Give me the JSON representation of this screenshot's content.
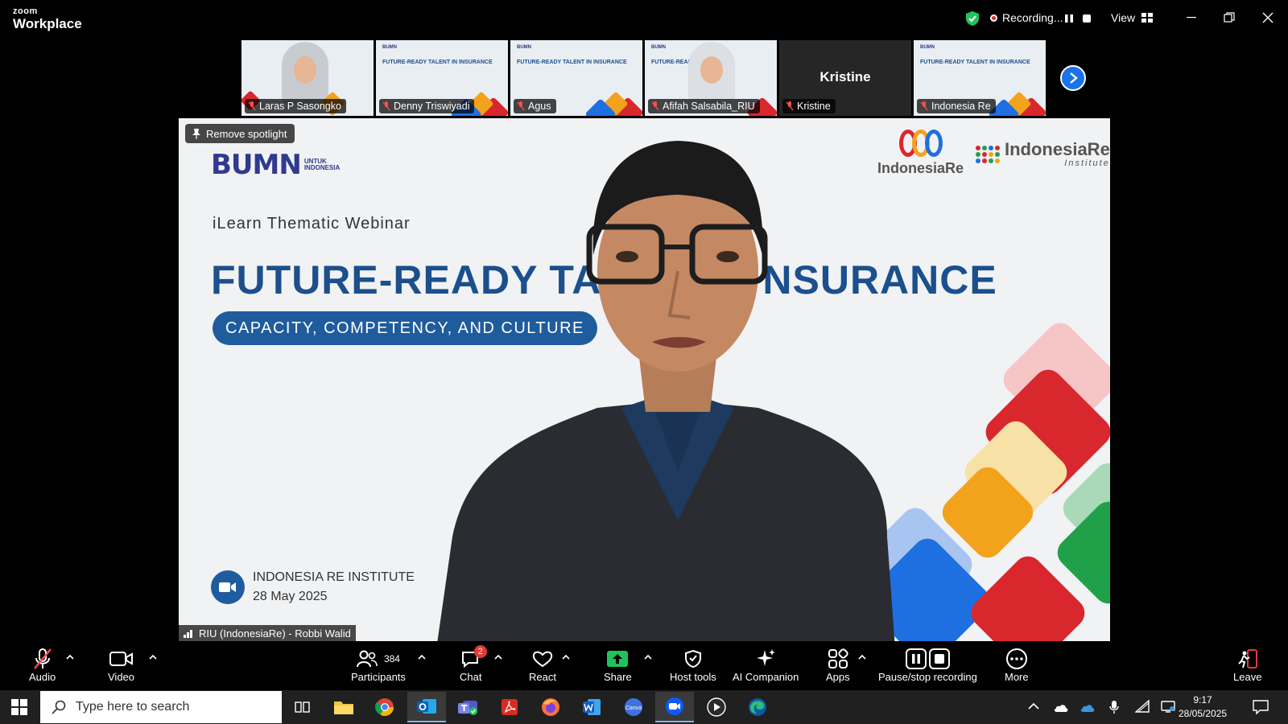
{
  "titlebar": {
    "brand_top": "zoom",
    "brand_bottom": "Workplace",
    "recording_label": "Recording...",
    "view_label": "View"
  },
  "thumbnails": [
    {
      "name": "Laras P Sasongko",
      "kind": "video"
    },
    {
      "name": "Denny Triswiyadi",
      "kind": "slide"
    },
    {
      "name": "Agus",
      "kind": "slide"
    },
    {
      "name": "Afifah Salsabila_RIU",
      "kind": "video"
    },
    {
      "name": "Kristine",
      "kind": "name",
      "display": "Kristine"
    },
    {
      "name": "Indonesia Re",
      "kind": "slide"
    }
  ],
  "stage": {
    "spotlight_label": "Remove spotlight",
    "bumn_word": "BUMN",
    "bumn_small_1": "UNTUK",
    "bumn_small_2": "INDONESIA",
    "ir_logo": "IndonesiaRe",
    "iri_logo_1": "IndonesiaRe",
    "iri_logo_2": "Institute",
    "webinar_subtitle": "iLearn Thematic Webinar",
    "headline_left": "FUTURE-READY TA",
    "headline_right": "NSURANCE",
    "pill": "CAPACITY, COMPETENCY, AND CULTURE",
    "institute": "INDONESIA RE INSTITUTE",
    "date": "28 May 2025",
    "speaker": "RIU (IndonesiaRe) - Robbi Walid"
  },
  "toolbar": {
    "audio": "Audio",
    "video": "Video",
    "participants": "Participants",
    "participants_count": "384",
    "chat": "Chat",
    "chat_badge": "2",
    "react": "React",
    "share": "Share",
    "host_tools": "Host tools",
    "ai_companion": "AI Companion",
    "apps": "Apps",
    "pause_stop": "Pause/stop recording",
    "more": "More",
    "leave": "Leave"
  },
  "taskbar": {
    "search_placeholder": "Type here to search",
    "time": "9:17",
    "date": "28/05/2025"
  },
  "colors": {
    "accent_blue": "#1a73e8",
    "brand_navy": "#1b4f8d",
    "recording_red": "#e02828",
    "share_green": "#21c25e"
  }
}
